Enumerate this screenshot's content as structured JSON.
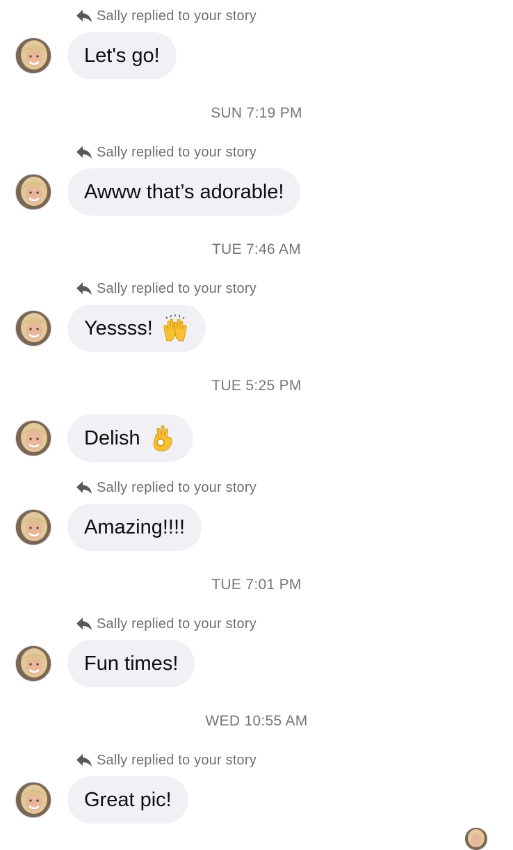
{
  "thread": {
    "items": [
      {
        "kind": "reply",
        "text": "Sally replied to your story"
      },
      {
        "kind": "message",
        "text": "Let's go!"
      },
      {
        "kind": "time",
        "text": "SUN 7:19 PM"
      },
      {
        "kind": "reply",
        "text": "Sally replied to your story"
      },
      {
        "kind": "message",
        "text": "Awww that’s adorable!"
      },
      {
        "kind": "time",
        "text": "TUE 7:46 AM"
      },
      {
        "kind": "reply",
        "text": "Sally replied to your story"
      },
      {
        "kind": "message",
        "text": "Yessss!",
        "emoji": "raising-hands-emoji"
      },
      {
        "kind": "time",
        "text": "TUE 5:25 PM"
      },
      {
        "kind": "message",
        "text": "Delish",
        "emoji": "ok-hand-emoji"
      },
      {
        "kind": "reply",
        "text": "Sally replied to your story"
      },
      {
        "kind": "message",
        "text": "Amazing!!!!"
      },
      {
        "kind": "time",
        "text": "TUE 7:01 PM"
      },
      {
        "kind": "reply",
        "text": "Sally replied to your story"
      },
      {
        "kind": "message",
        "text": "Fun times!"
      },
      {
        "kind": "time",
        "text": "WED 10:55 AM"
      },
      {
        "kind": "reply",
        "text": "Sally replied to your story"
      },
      {
        "kind": "message",
        "text": "Great pic!"
      }
    ]
  },
  "icons": {
    "reply": "reply-arrow-icon",
    "avatar": "sally-avatar"
  },
  "colors": {
    "bubble": "#f1f1f5",
    "meta_text": "#707074",
    "message_text": "#0d0d0d",
    "emoji_yellow": "#f7c132"
  }
}
